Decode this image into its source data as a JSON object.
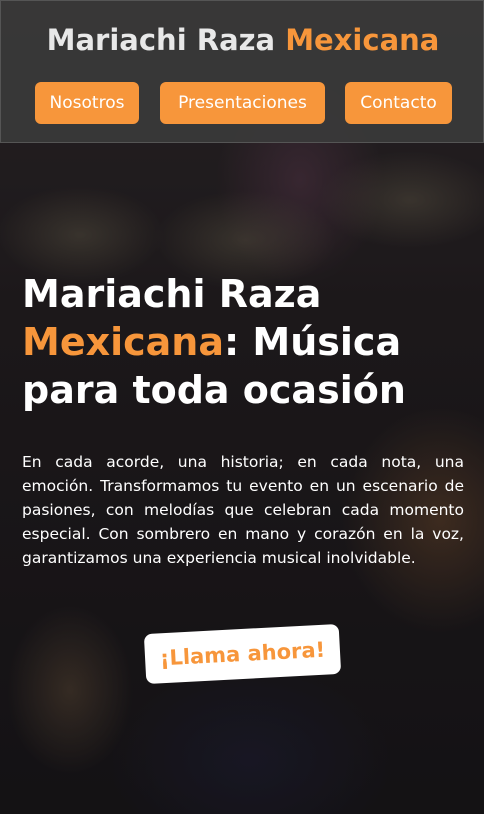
{
  "theme": {
    "accent": "#f7963b"
  },
  "header": {
    "title_part1": "Mariachi Raza",
    "title_part2": "Mexicana"
  },
  "nav": {
    "items": [
      {
        "label": "Nosotros"
      },
      {
        "label": "Presentaciones"
      },
      {
        "label": "Contacto"
      }
    ]
  },
  "hero": {
    "title_part1": "Mariachi Raza",
    "title_accent": "Mexicana",
    "title_part2": ": Música para toda ocasión",
    "description": "En cada acorde, una historia; en cada nota, una emoción. Transformamos tu evento en un escenario de pasiones, con melodías que celebran cada momento especial. Con sombrero en mano y corazón en la voz, garantizamos una experiencia musical inolvidable.",
    "cta_label": "¡Llama ahora!"
  }
}
